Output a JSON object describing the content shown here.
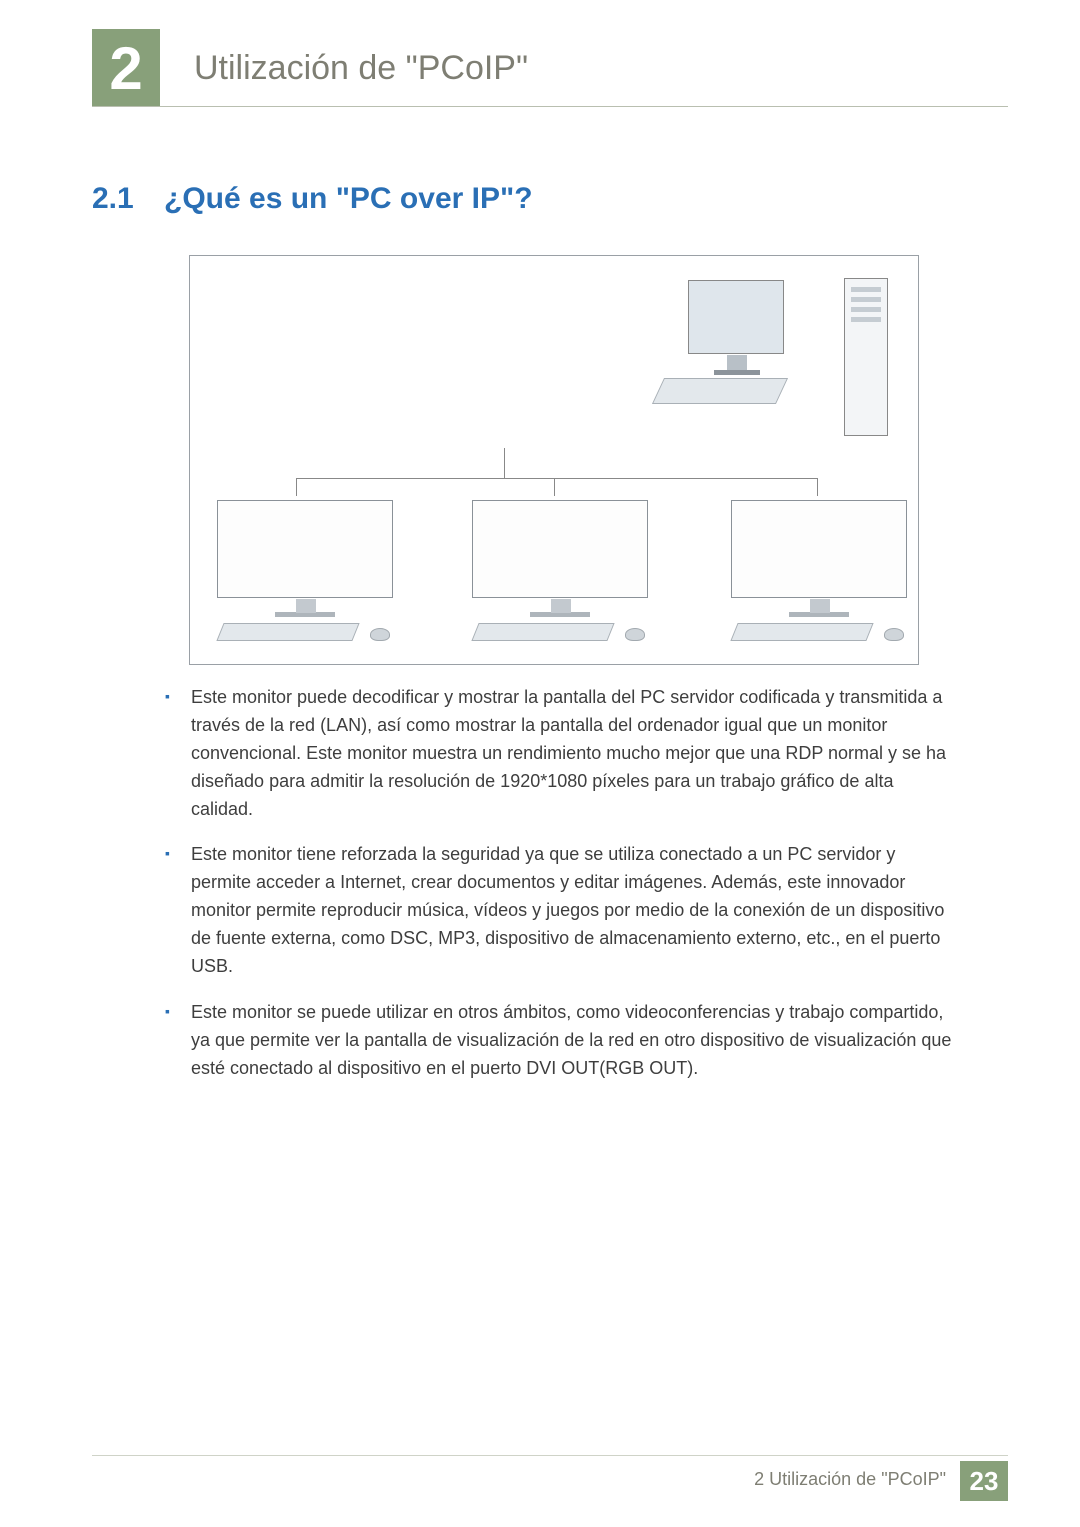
{
  "chapter": {
    "number": "2",
    "title": "Utilización de \"PCoIP\""
  },
  "section": {
    "number": "2.1",
    "title": "¿Qué es un \"PC over IP\"?"
  },
  "bullets": [
    "Este monitor puede decodificar y mostrar la pantalla del PC servidor codificada y transmitida a través de la red (LAN), así como mostrar la pantalla del ordenador igual que un monitor convencional. Este monitor muestra un rendimiento mucho mejor que una RDP normal y se ha diseñado para admitir la resolución de 1920*1080 píxeles para un trabajo gráfico de alta calidad.",
    "Este monitor tiene reforzada la seguridad ya que se utiliza conectado a un PC servidor y permite acceder a Internet, crear documentos y editar imágenes. Además, este innovador monitor permite reproducir música, vídeos y juegos por medio de la conexión de un dispositivo de fuente externa, como DSC, MP3, dispositivo de almacenamiento externo, etc., en el puerto USB.",
    "Este monitor se puede utilizar en otros ámbitos, como videoconferencias y trabajo compartido, ya que permite ver la pantalla de visualización de la red en otro dispositivo de visualización que esté conectado al dispositivo en el puerto DVI OUT(RGB OUT)."
  ],
  "footer": {
    "label": "2 Utilización de \"PCoIP\"",
    "page": "23"
  }
}
